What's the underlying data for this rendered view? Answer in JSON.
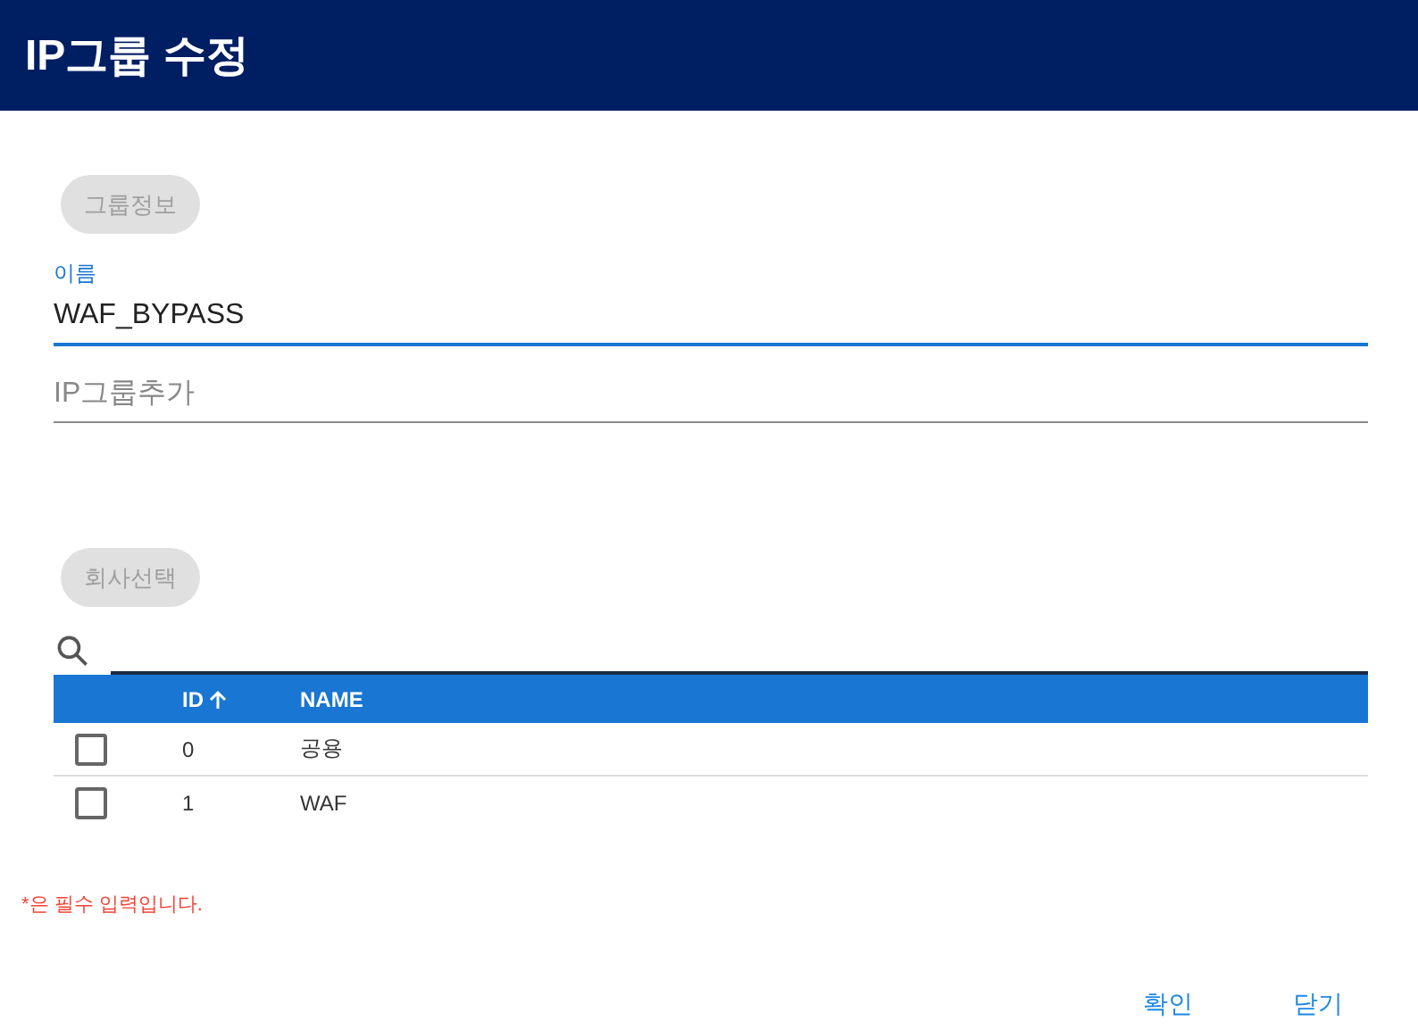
{
  "window": {
    "title": "IP그룹 수정"
  },
  "group_info_chip": "그룹정보",
  "name_field": {
    "label": "이름",
    "value": "WAF_BYPASS",
    "focused": true
  },
  "ip_group_field": {
    "placeholder": "IP그룹추가"
  },
  "company_chip": "회사선택",
  "table": {
    "columns": [
      {
        "label": "ID",
        "sorted": true
      },
      {
        "label": "NAME",
        "sorted": false
      }
    ],
    "rows": [
      {
        "id": "0",
        "name": "공용",
        "checked": false
      },
      {
        "id": "1",
        "name": "WAF",
        "checked": false
      }
    ]
  },
  "required_note": "*은 필수 입력입니다.",
  "buttons": [
    "확인",
    "닫기"
  ]
}
